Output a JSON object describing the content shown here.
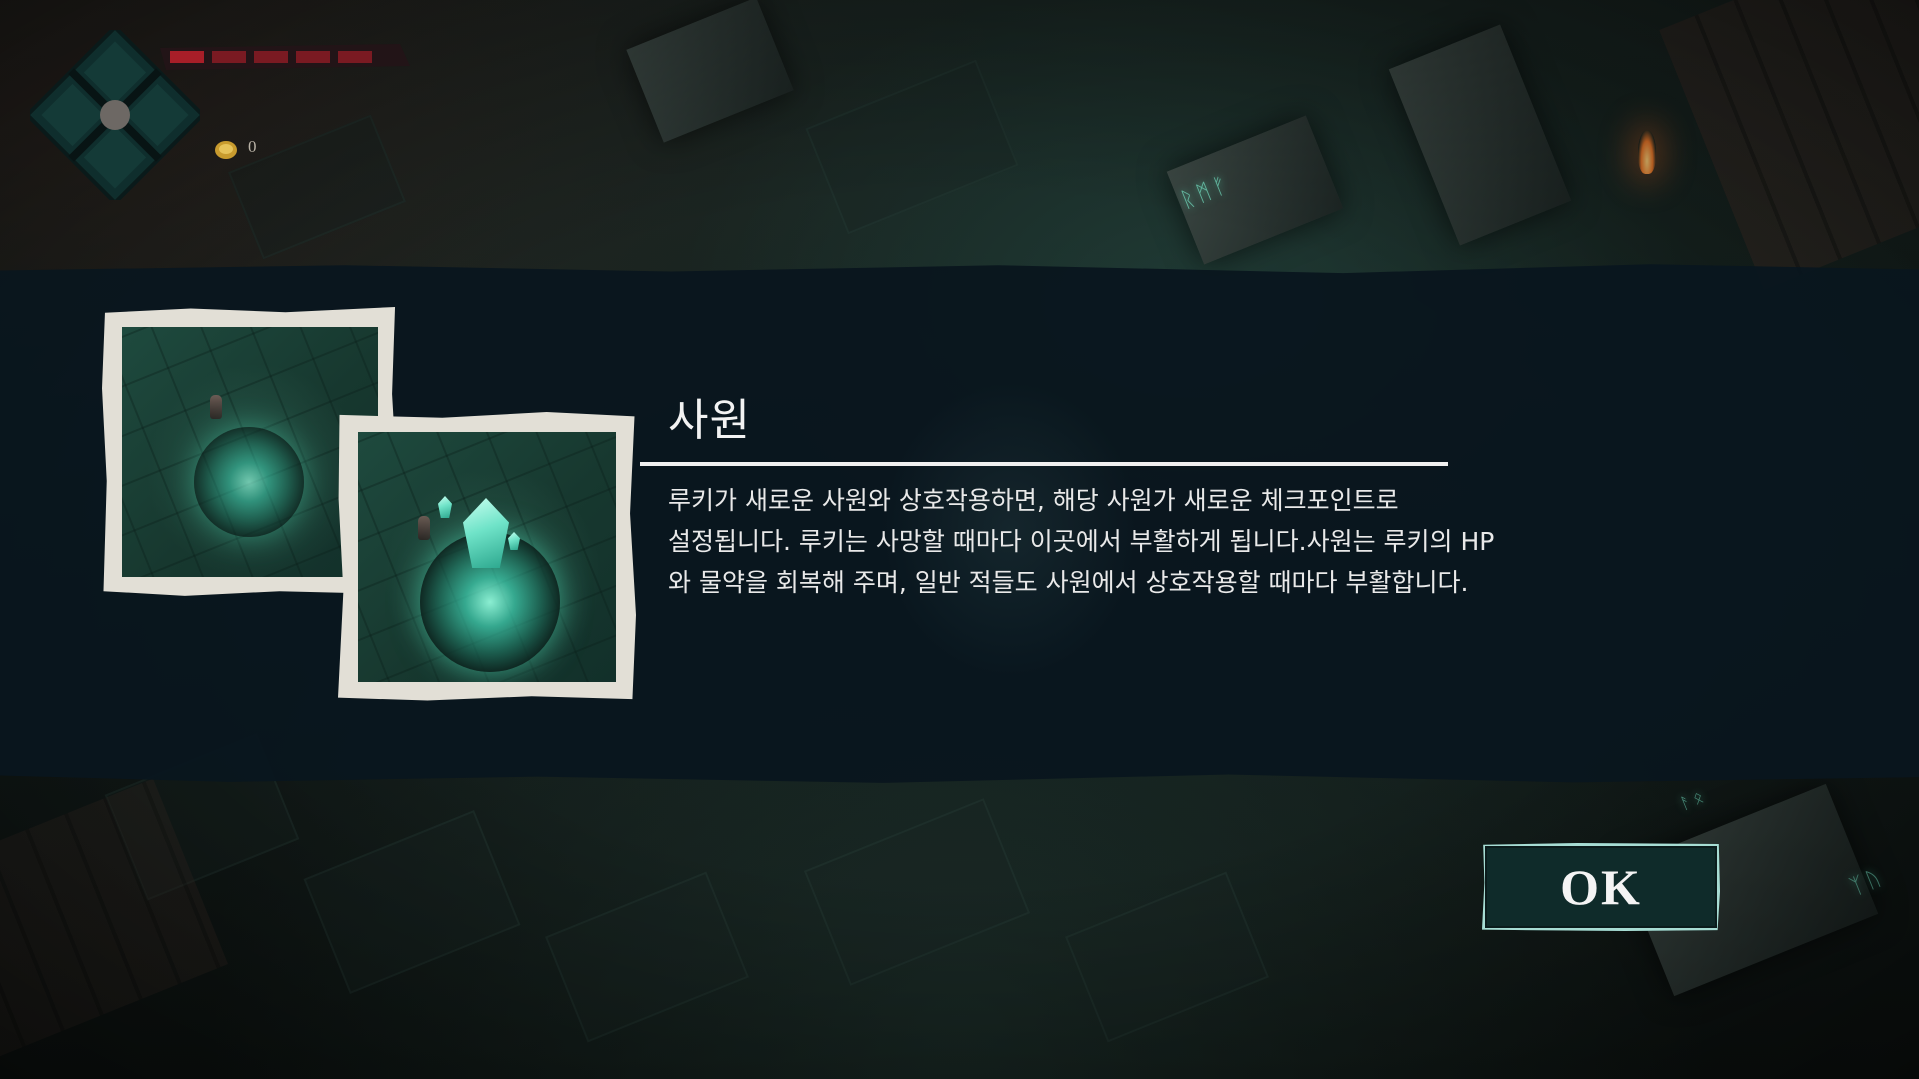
{
  "hud": {
    "coin_count": "0",
    "emblem_icon": "diamond-emblem-icon",
    "health_icon": "health-bar-icon",
    "coin_icon": "gold-coin-icon"
  },
  "tutorial": {
    "title": "사원",
    "description_lines": [
      "루키가 새로운 사원와 상호작용하면, 해당 사원가 새로운 체크포인트로",
      "설정됩니다. 루키는 사망할 때마다 이곳에서 부활하게 됩니다.사원는 루키의 HP",
      "와 물약을 회복해 주며, 일반 적들도 사원에서 상호작용할 때마다 부활합니다."
    ],
    "images": [
      "shrine-inactive-illustration",
      "shrine-active-illustration"
    ]
  },
  "ok_button": {
    "label": "OK"
  },
  "colors": {
    "banner": "#09161e",
    "accent": "#a7ddd4",
    "shrine_glow": "#6fe3c8",
    "health": "#a81e28"
  }
}
